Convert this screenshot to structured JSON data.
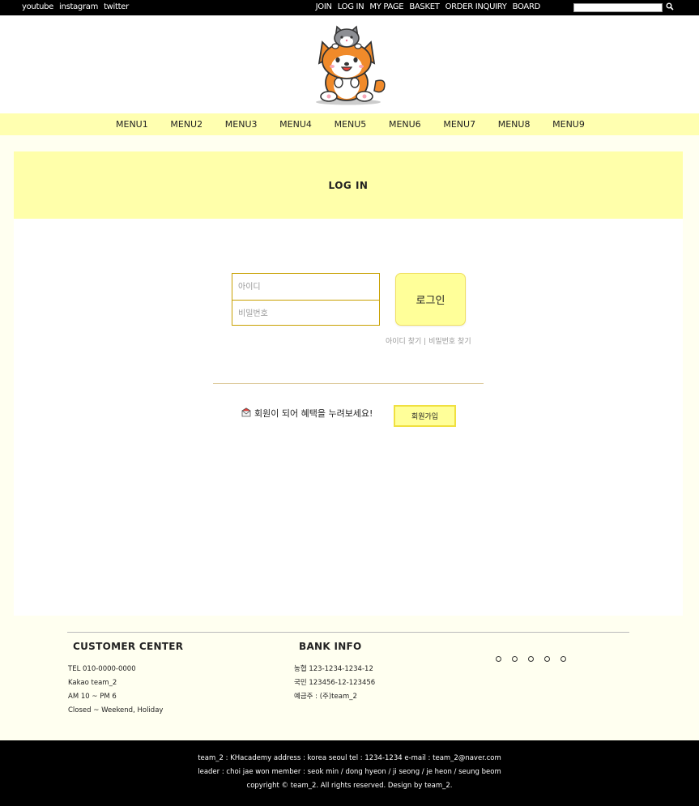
{
  "topbar": {
    "social": [
      "youtube",
      "instagram",
      "twitter"
    ],
    "usermenu": [
      "JOIN",
      "LOG IN",
      "MY PAGE",
      "BASKET",
      "ORDER INQUIRY",
      "BOARD"
    ],
    "search_value": "",
    "search_icon": "magnifier-icon"
  },
  "nav": {
    "items": [
      "MENU1",
      "MENU2",
      "MENU3",
      "MENU4",
      "MENU5",
      "MENU6",
      "MENU7",
      "MENU8",
      "MENU9"
    ]
  },
  "page": {
    "title": "LOG IN"
  },
  "login": {
    "id_placeholder": "아이디",
    "pw_placeholder": "비밀번호",
    "button": "로그인",
    "find_id": "아이디 찾기",
    "find_sep": "|",
    "find_pw": "비밀번호 찾기"
  },
  "join": {
    "icon": "envelope-icon",
    "message": "회원이 되어 혜택을 누려보세요!",
    "button": "회원가입"
  },
  "footer": {
    "customer": {
      "title": "CUSTOMER CENTER",
      "lines": [
        "TEL 010-0000-0000",
        "Kakao team_2",
        "AM 10 ~ PM 6",
        "Closed ~ Weekend, Holiday"
      ]
    },
    "bank": {
      "title": "BANK INFO",
      "lines": [
        "농협 123-1234-1234-12",
        "국민 123456-12-123456",
        "예금주 : (주)team_2"
      ]
    },
    "dots": 5
  },
  "bottom": {
    "line1": "team_2 : KHacademy address : korea seoul  tel : 1234-1234  e-mail : team_2@naver.com",
    "line2": "leader : choi jae won member : seok min / dong hyeon / ji seong / je heon / seung beom",
    "line3": "copyright © team_2. All rights reserved. Design by team_2."
  },
  "colors": {
    "accent_yellow": "#ffffaa",
    "button_yellow": "#ffff99",
    "border_gold": "#c8a000",
    "page_bg": "#fffff0"
  }
}
